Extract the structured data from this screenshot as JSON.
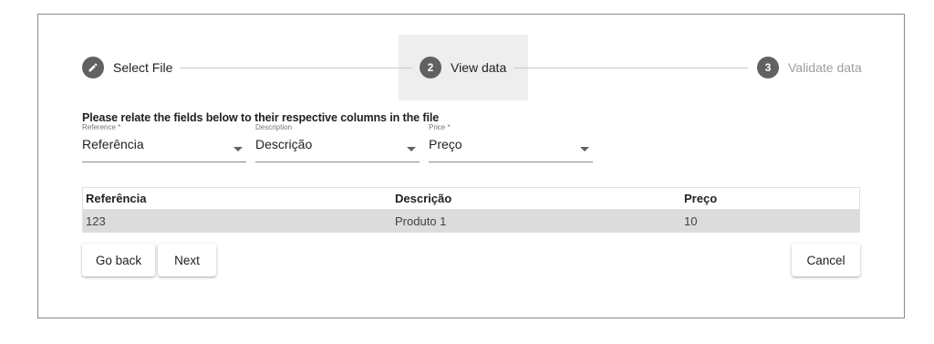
{
  "stepper": {
    "steps": [
      {
        "number": "",
        "label": "Select File",
        "icon": "pencil-icon"
      },
      {
        "number": "2",
        "label": "View data"
      },
      {
        "number": "3",
        "label": "Validate data"
      }
    ]
  },
  "form": {
    "instruction": "Please relate the fields below to their respective columns in the file",
    "fields": [
      {
        "label": "Reference *",
        "value": "Referência"
      },
      {
        "label": "Description",
        "value": "Descrição"
      },
      {
        "label": "Price *",
        "value": "Preço"
      }
    ]
  },
  "table": {
    "headers": [
      "Referência",
      "Descrição",
      "Preço"
    ],
    "rows": [
      [
        "123",
        "Produto 1",
        "10"
      ]
    ]
  },
  "buttons": {
    "back": "Go back",
    "next": "Next",
    "cancel": "Cancel"
  },
  "colors": {
    "step_active_bg": "#eeeeee",
    "step_circle": "#616161",
    "row_bg": "#dcdcdc"
  }
}
